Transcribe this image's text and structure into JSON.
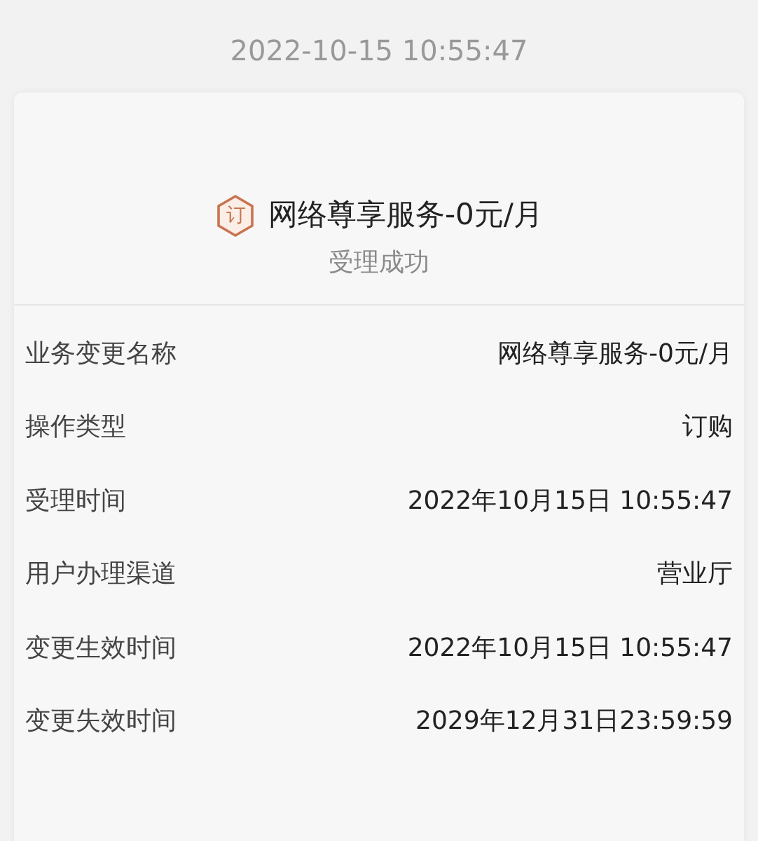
{
  "timestamp": "2022-10-15 10:55:47",
  "header": {
    "badge": "订",
    "title": "网络尊享服务-0元/月",
    "status": "受理成功"
  },
  "details": [
    {
      "label": "业务变更名称",
      "value": "网络尊享服务-0元/月"
    },
    {
      "label": "操作类型",
      "value": "订购"
    },
    {
      "label": "受理时间",
      "value": "2022年10月15日 10:55:47"
    },
    {
      "label": "用户办理渠道",
      "value": "营业厅"
    },
    {
      "label": "变更生效时间",
      "value": "2022年10月15日 10:55:47"
    },
    {
      "label": "变更失效时间",
      "value": "2029年12月31日23:59:59"
    }
  ]
}
